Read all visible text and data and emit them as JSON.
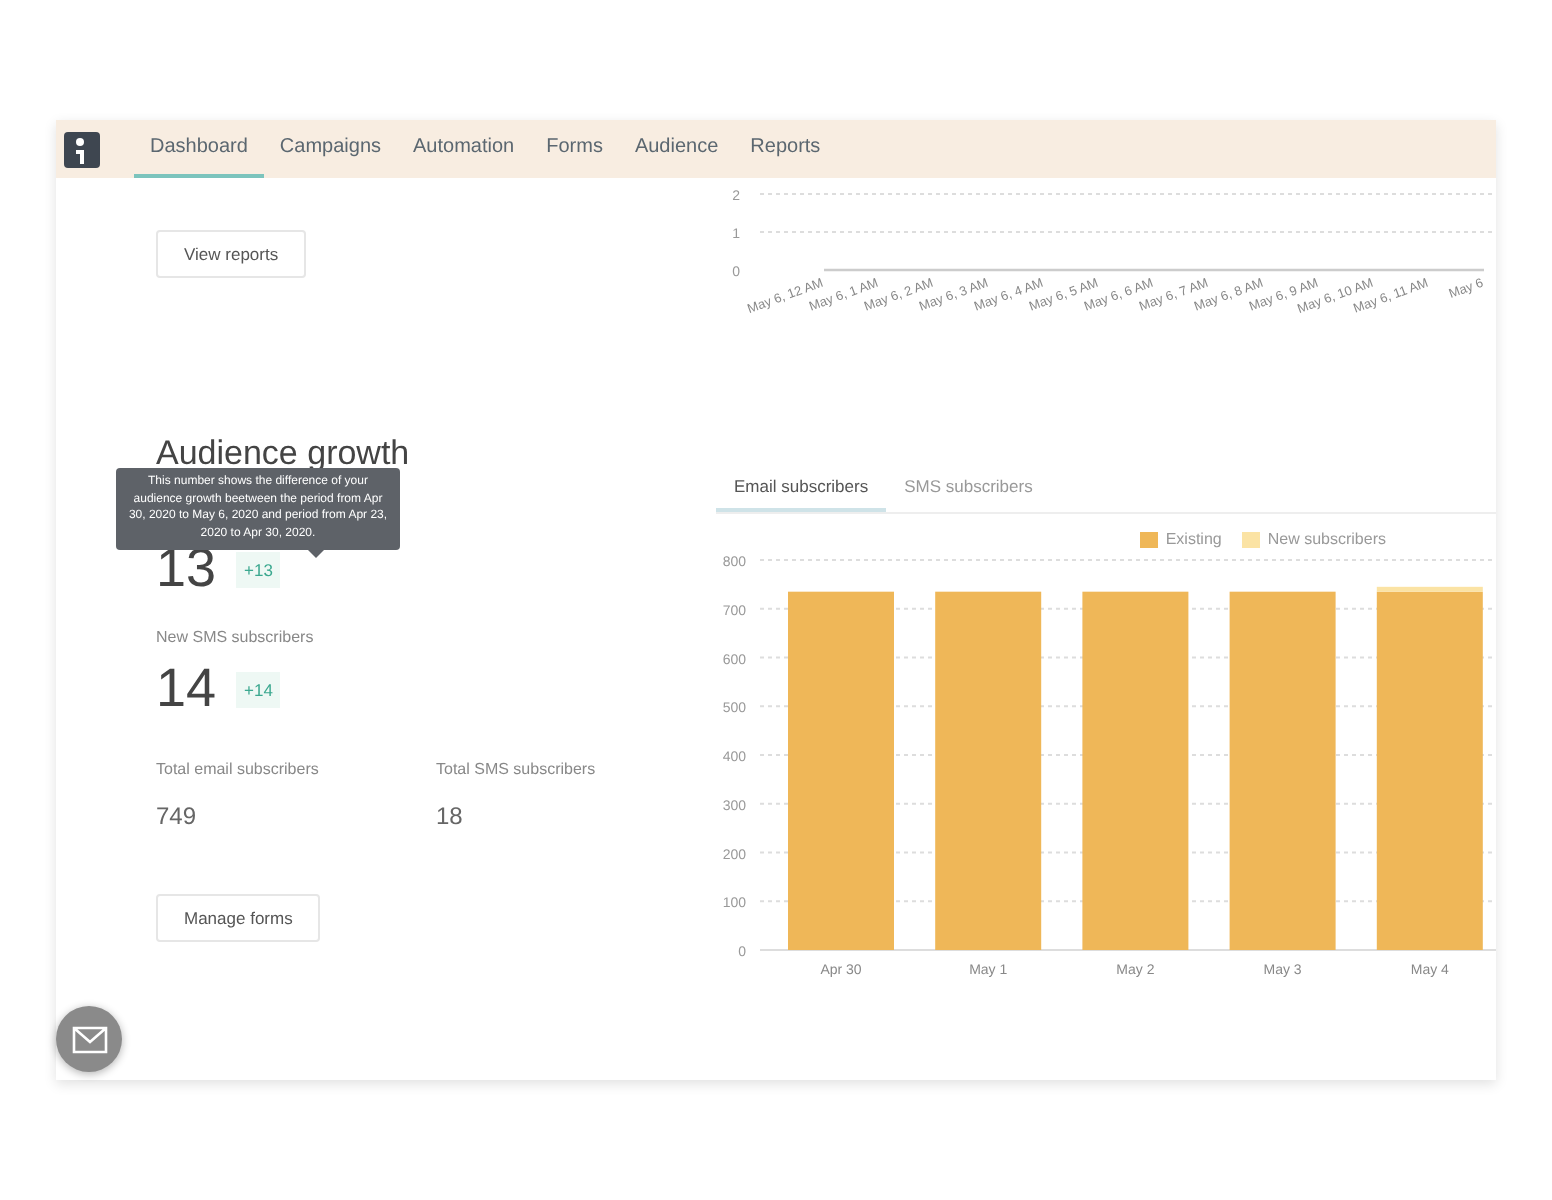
{
  "nav": {
    "tabs": [
      {
        "label": "Dashboard",
        "selected": true
      },
      {
        "label": "Campaigns",
        "selected": false
      },
      {
        "label": "Automation",
        "selected": false
      },
      {
        "label": "Forms",
        "selected": false
      },
      {
        "label": "Audience",
        "selected": false
      },
      {
        "label": "Reports",
        "selected": false
      }
    ]
  },
  "left": {
    "view_reports": "View reports",
    "heading": "Audience growth",
    "tooltip": "This number shows the difference of your audience growth beetween the period from Apr 30, 2020 to May 6, 2020 and period from Apr 23, 2020 to Apr 30, 2020.",
    "stats": [
      {
        "value": "13",
        "delta": "+13"
      },
      {
        "label": "New SMS subscribers",
        "value": "14",
        "delta": "+14"
      }
    ],
    "totals": [
      {
        "label": "Total email subscribers",
        "value": "749"
      },
      {
        "label": "Total SMS subscribers",
        "value": "18"
      }
    ],
    "manage_forms": "Manage forms"
  },
  "hourly_chart": {
    "chart_data": {
      "type": "line",
      "categories": [
        "May 6, 12 AM",
        "May 6, 1 AM",
        "May 6, 2 AM",
        "May 6, 3 AM",
        "May 6, 4 AM",
        "May 6, 5 AM",
        "May 6, 6 AM",
        "May 6, 7 AM",
        "May 6, 8 AM",
        "May 6, 9 AM",
        "May 6, 10 AM",
        "May 6, 11 AM",
        "May 6"
      ],
      "values": [
        0,
        0,
        0,
        0,
        0,
        0,
        0,
        0,
        0,
        0,
        0,
        0,
        0
      ],
      "ylim": [
        0,
        2
      ],
      "yticks": [
        0,
        1,
        2
      ]
    }
  },
  "subscribers": {
    "tabs": [
      {
        "label": "Email subscribers",
        "selected": true
      },
      {
        "label": "SMS subscribers",
        "selected": false
      }
    ],
    "chart_data": {
      "type": "bar",
      "stacked": true,
      "categories": [
        "Apr 30",
        "May 1",
        "May 2",
        "May 3",
        "May 4"
      ],
      "series": [
        {
          "name": "Existing",
          "color": "#efb758",
          "values": [
            735,
            735,
            735,
            735,
            735
          ]
        },
        {
          "name": "New subscribers",
          "color": "#fbe3a4",
          "values": [
            0,
            0,
            0,
            0,
            10
          ]
        }
      ],
      "ylim": [
        0,
        800
      ],
      "grid": true,
      "yticks": [
        0,
        100,
        200,
        300,
        400,
        500,
        600,
        700,
        800
      ]
    }
  }
}
